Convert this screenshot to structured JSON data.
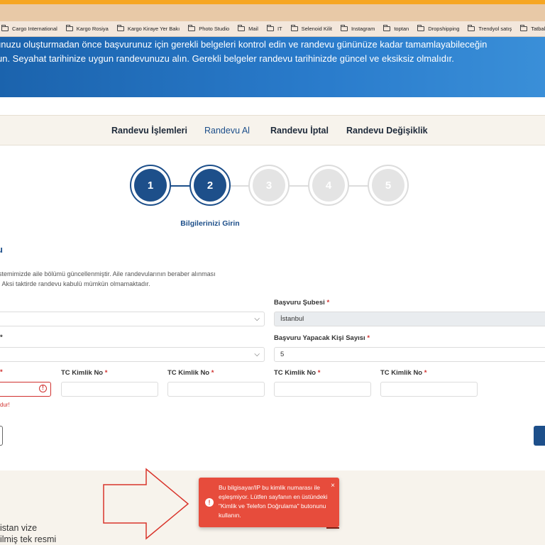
{
  "bookmarks": [
    "Cargo International",
    "Kargo Rosiya",
    "Kargo Kiraye Yer Bakı",
    "Photo Studio",
    "Mail",
    "IT",
    "Selenoid Kilit",
    "Instagram",
    "toptan",
    "Dropshipping",
    "Trendyol satış",
    "Tatbakal"
  ],
  "hero": {
    "line1": "unuzu oluşturmadan önce başvurunuz için gerekli belgeleri kontrol edin ve randevu gününüze kadar tamamlayabileceğin",
    "line2": "un. Seyahat tarihinize uygun randevunuzu alın. Gerekli belgeler randevu tarihinizde güncel ve eksiksiz olmalıdır."
  },
  "nav": {
    "items": [
      "Randevu İşlemleri",
      "Randevu Al",
      "Randevu İptal",
      "Randevu Değişiklik"
    ],
    "active_index": 1
  },
  "steps": {
    "numbers": [
      "1",
      "2",
      "3",
      "4",
      "5"
    ],
    "completed": 2,
    "current_label": "Bilgilerinizi Girin"
  },
  "form": {
    "section_title": "u",
    "notice_line1": "stemimizde aile bölümü güncellenmiştir. Aile randevularının beraber alınması",
    "notice_line2": ". Aksi taktirde randevu kabulü mümkün olmamaktadır.",
    "branch_label": "Başvuru Şubesi",
    "branch_value": "İstanbul",
    "persons_label": "Başvuru Yapacak Kişi Sayısı",
    "persons_value": "5",
    "tc_label": "TC Kimlik No",
    "required_mark": "*",
    "error_text": "dur!",
    "error_icon": "!"
  },
  "footer": {
    "line1": "istan vize",
    "line2": "ilmiş tek resmi"
  },
  "toast": {
    "message": "Bu bilgisayar/IP bu kimlik numarası ile eşleşmiyor. Lütfen sayfanın en üstündeki \"Kimlik ve Telefon Doğrulama\" butonunu kullanın.",
    "close": "×",
    "icon": "!"
  },
  "colors": {
    "primary": "#1d4f8a",
    "error": "#d0302e",
    "toast": "#e74c3c",
    "arrow": "#d9342b"
  }
}
